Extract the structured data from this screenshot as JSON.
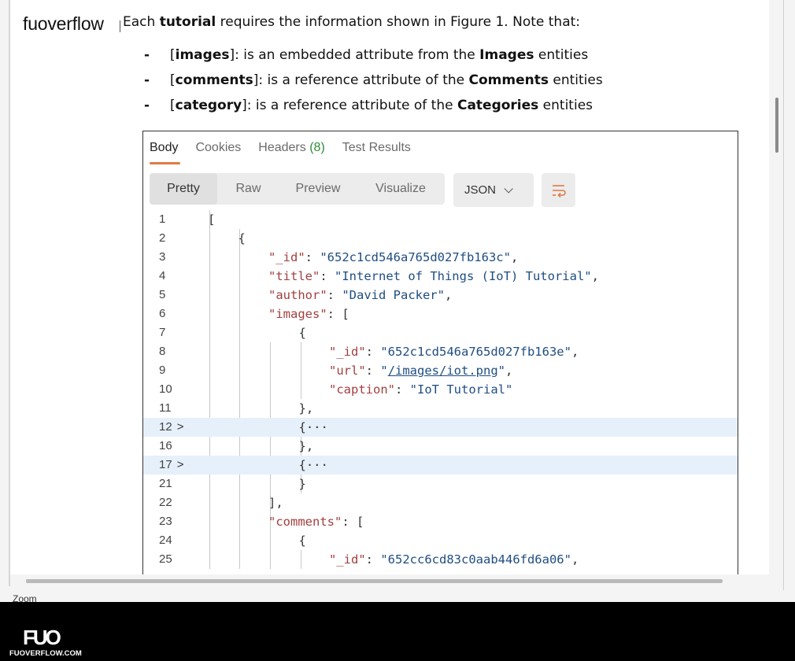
{
  "brand": "fuoverflow",
  "intro": {
    "pre": "Each ",
    "bold": "tutorial",
    "post": " requires the information shown in Figure 1. Note that:"
  },
  "bullets": [
    {
      "dash": "-",
      "open": "[",
      "bold_attr": "images",
      "mid": "]: is an embedded attribute from the ",
      "bold_entity": "Images",
      "end": " entities"
    },
    {
      "dash": "-",
      "open": "[",
      "bold_attr": "comments",
      "mid": "]: is a reference attribute of the ",
      "bold_entity": "Comments",
      "end": " entities"
    },
    {
      "dash": "-",
      "open": "[",
      "bold_attr": "category",
      "mid": "]: is a reference attribute of the ",
      "bold_entity": "Categories",
      "end": " entities"
    }
  ],
  "response_tabs": {
    "body": "Body",
    "cookies": "Cookies",
    "headers": "Headers",
    "headers_count": "(8)",
    "test_results": "Test Results"
  },
  "view_modes": [
    "Pretty",
    "Raw",
    "Preview",
    "Visualize"
  ],
  "format_select": {
    "value": "JSON"
  },
  "code_lines": [
    {
      "num": "1",
      "fold": "",
      "tokens": [
        [
          "p",
          "["
        ]
      ]
    },
    {
      "num": "2",
      "fold": "",
      "tokens": [
        [
          "p",
          "{"
        ]
      ]
    },
    {
      "num": "3",
      "fold": "",
      "tokens": [
        [
          "k",
          "\"_id\""
        ],
        [
          "p",
          ": "
        ],
        [
          "s",
          "\"652c1cd546a765d027fb163c\""
        ],
        [
          "p",
          ","
        ]
      ]
    },
    {
      "num": "4",
      "fold": "",
      "tokens": [
        [
          "k",
          "\"title\""
        ],
        [
          "p",
          ": "
        ],
        [
          "s",
          "\"Internet of Things (IoT) Tutorial\""
        ],
        [
          "p",
          ","
        ]
      ]
    },
    {
      "num": "5",
      "fold": "",
      "tokens": [
        [
          "k",
          "\"author\""
        ],
        [
          "p",
          ": "
        ],
        [
          "s",
          "\"David Packer\""
        ],
        [
          "p",
          ","
        ]
      ]
    },
    {
      "num": "6",
      "fold": "",
      "tokens": [
        [
          "k",
          "\"images\""
        ],
        [
          "p",
          ": ["
        ]
      ]
    },
    {
      "num": "7",
      "fold": "",
      "tokens": [
        [
          "p",
          "{"
        ]
      ]
    },
    {
      "num": "8",
      "fold": "",
      "tokens": [
        [
          "k",
          "\"_id\""
        ],
        [
          "p",
          ": "
        ],
        [
          "s",
          "\"652c1cd546a765d027fb163e\""
        ],
        [
          "p",
          ","
        ]
      ]
    },
    {
      "num": "9",
      "fold": "",
      "tokens": [
        [
          "k",
          "\"url\""
        ],
        [
          "p",
          ": "
        ],
        [
          "s",
          "\""
        ],
        [
          "u",
          "/images/iot.png"
        ],
        [
          "s",
          "\""
        ],
        [
          "p",
          ","
        ]
      ]
    },
    {
      "num": "10",
      "fold": "",
      "tokens": [
        [
          "k",
          "\"caption\""
        ],
        [
          "p",
          ": "
        ],
        [
          "s",
          "\"IoT Tutorial\""
        ]
      ]
    },
    {
      "num": "11",
      "fold": "",
      "tokens": [
        [
          "p",
          "},"
        ]
      ]
    },
    {
      "num": "12",
      "fold": ">",
      "tokens": [
        [
          "p",
          "{···"
        ]
      ]
    },
    {
      "num": "16",
      "fold": "",
      "tokens": [
        [
          "p",
          "},"
        ]
      ]
    },
    {
      "num": "17",
      "fold": ">",
      "tokens": [
        [
          "p",
          "{···"
        ]
      ]
    },
    {
      "num": "21",
      "fold": "",
      "tokens": [
        [
          "p",
          "}"
        ]
      ]
    },
    {
      "num": "22",
      "fold": "",
      "tokens": [
        [
          "p",
          "],"
        ]
      ]
    },
    {
      "num": "23",
      "fold": "",
      "tokens": [
        [
          "k",
          "\"comments\""
        ],
        [
          "p",
          ": ["
        ]
      ]
    },
    {
      "num": "24",
      "fold": "",
      "tokens": [
        [
          "p",
          "{"
        ]
      ]
    },
    {
      "num": "25",
      "fold": "",
      "tokens": [
        [
          "k",
          "\"_id\""
        ],
        [
          "p",
          ": "
        ],
        [
          "s",
          "\"652cc6cd83c0aab446fd6a06\""
        ],
        [
          "p",
          ","
        ]
      ]
    }
  ],
  "zoom_label": "Zoom",
  "footer": {
    "logo_mark": "FUO",
    "logo_text": "FUOVERFLOW.COM"
  }
}
